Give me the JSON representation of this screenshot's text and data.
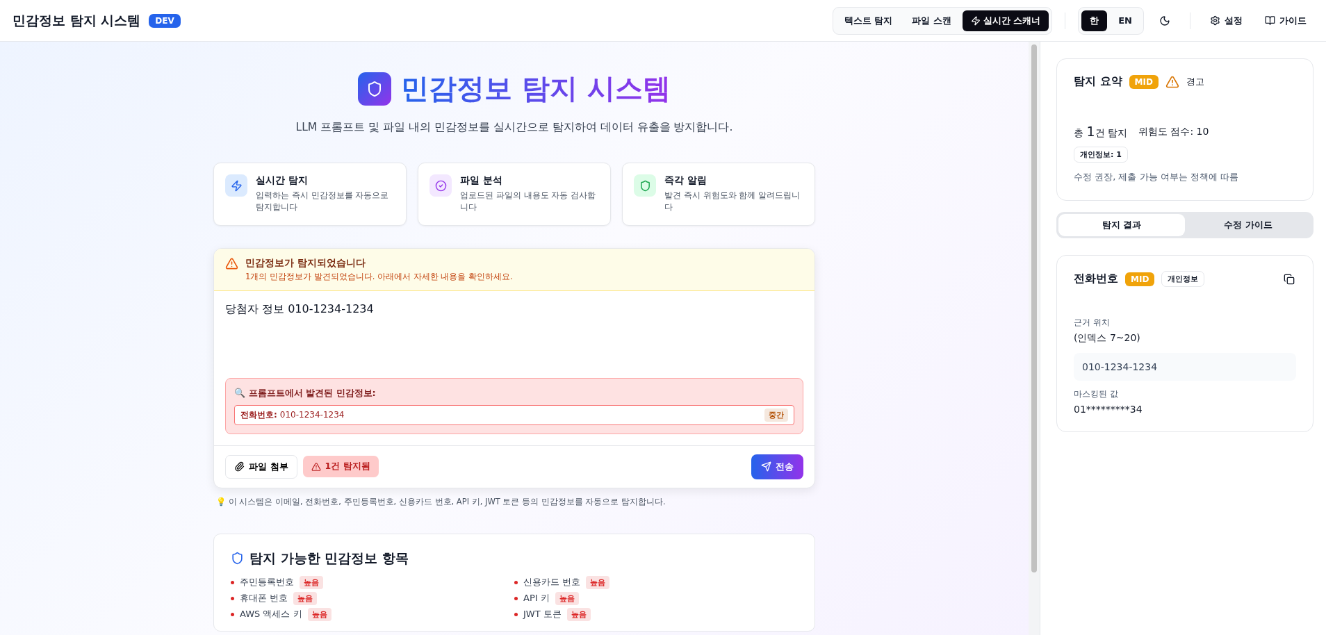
{
  "header": {
    "title": "민감정보 탐지 시스템",
    "env_badge": "DEV",
    "mode_tabs": [
      {
        "kind": "plain",
        "label": "텍스트 탐지",
        "selected": false
      },
      {
        "kind": "plain",
        "label": "파일 스캔",
        "selected": false
      },
      {
        "kind": "bolt",
        "label": "실시간 스캐너",
        "selected": true
      }
    ],
    "languages": [
      {
        "label": "한",
        "selected": true
      },
      {
        "label": "EN",
        "selected": false
      }
    ],
    "settings_label": "설정",
    "guide_label": "가이드"
  },
  "hero": {
    "title": "민감정보 탐지 시스템",
    "subtitle": "LLM 프롬프트 및 파일 내의 민감정보를 실시간으로 탐지하여 데이터 유출을 방지합니다."
  },
  "features": [
    {
      "kind": "bolt",
      "title": "실시간 탐지",
      "desc": "입력하는 즉시 민감정보를 자동으로 탐지합니다"
    },
    {
      "kind": "check",
      "title": "파일 분석",
      "desc": "업로드된 파일의 내용도 자동 검사합니다"
    },
    {
      "kind": "shield",
      "title": "즉각 알림",
      "desc": "발견 즉시 위험도와 함께 알려드립니다"
    }
  ],
  "alert": {
    "title": "민감정보가 탐지되었습니다",
    "message": "1개의 민감정보가 발견되었습니다. 아래에서 자세한 내용을 확인하세요."
  },
  "prompt": {
    "value": "당첨자 정보 010-1234-1234"
  },
  "findings": {
    "heading": "🔍 프롬프트에서 발견된 민감정보:",
    "items": [
      {
        "label": "전화번호:",
        "value": "010-1234-1234",
        "color": "#b45309",
        "severity_label": "중간"
      }
    ]
  },
  "actions": {
    "attach_label": "파일 첨부",
    "detected_label": "1건 탐지됨",
    "send_label": "전송"
  },
  "hint": "💡 이 시스템은 이메일, 전화번호, 주민등록번호, 신용카드 번호, API 키, JWT 토큰 등의 민감정보를 자동으로 탐지합니다.",
  "catalog": {
    "title": "탐지 가능한 민감정보 항목",
    "items": [
      {
        "label": "주민등록번호",
        "color": "#dc2626",
        "severity_label": "높음"
      },
      {
        "label": "신용카드 번호",
        "color": "#dc2626",
        "severity_label": "높음"
      },
      {
        "label": "휴대폰 번호",
        "color": "#dc2626",
        "severity_label": "높음"
      },
      {
        "label": "API 키",
        "color": "#dc2626",
        "severity_label": "높음"
      },
      {
        "label": "AWS 액세스 키",
        "color": "#dc2626",
        "severity_label": "높음"
      },
      {
        "label": "JWT 토큰",
        "color": "#dc2626",
        "severity_label": "높음"
      }
    ]
  },
  "summary": {
    "title": "탐지 요약",
    "color": "#f0a30a",
    "level_label": "MID",
    "status_label": "경고",
    "total": "총 **1**건 탐지",
    "score": "위험도 점수: 10",
    "category_chip": "개인정보: 1",
    "recommendation": "수정 권장, 제출 가능 여부는 정책에 따름"
  },
  "panel_tabs": [
    {
      "label": "탐지 결과",
      "selected": true
    },
    {
      "label": "수정 가이드",
      "selected": false
    }
  ],
  "result": {
    "type": "전화번호",
    "color": "#f0a30a",
    "level_label": "MID",
    "category": "개인정보",
    "location_label": "근거 위치",
    "location": "(인덱스 7~20)",
    "original": "010-1234-1234",
    "masked_label": "마스킹된 값",
    "masked": "01*********34"
  }
}
